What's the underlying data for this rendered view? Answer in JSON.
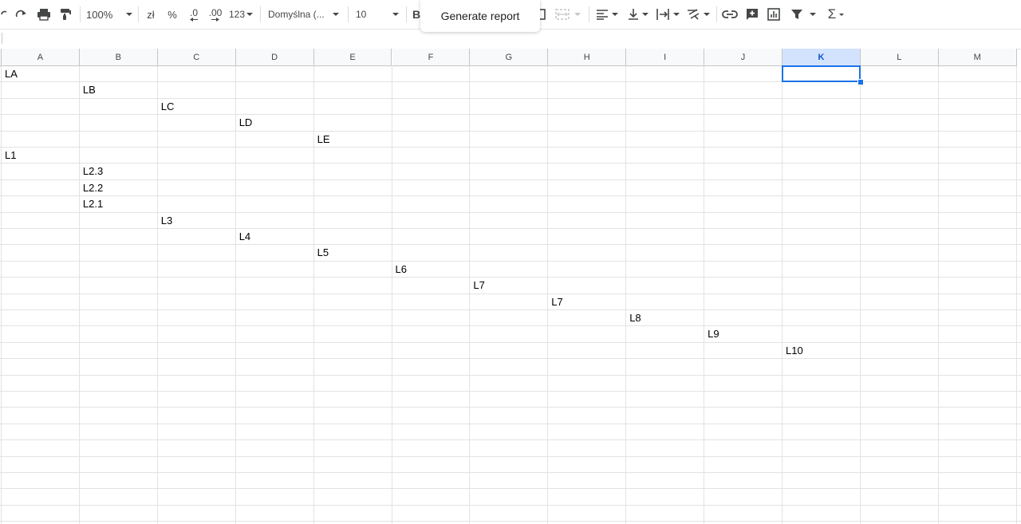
{
  "toolbar": {
    "zoom": "100%",
    "currency": "zł",
    "percent": "%",
    "decrease_decimals": ".0",
    "increase_decimals": ".00",
    "more_formats": "123",
    "font": "Domyślna (...",
    "font_size": "10"
  },
  "popup": {
    "label": "Generate report"
  },
  "columns": [
    "A",
    "B",
    "C",
    "D",
    "E",
    "F",
    "G",
    "H",
    "I",
    "J",
    "K",
    "L",
    "M"
  ],
  "selected_column": "K",
  "cells": [
    {
      "row": 1,
      "col": "A",
      "value": "LA"
    },
    {
      "row": 2,
      "col": "B",
      "value": "LB"
    },
    {
      "row": 3,
      "col": "C",
      "value": "LC"
    },
    {
      "row": 4,
      "col": "D",
      "value": "LD"
    },
    {
      "row": 5,
      "col": "E",
      "value": "LE"
    },
    {
      "row": 6,
      "col": "A",
      "value": "L1"
    },
    {
      "row": 7,
      "col": "B",
      "value": "L2.3"
    },
    {
      "row": 8,
      "col": "B",
      "value": "L2.2"
    },
    {
      "row": 9,
      "col": "B",
      "value": "L2.1"
    },
    {
      "row": 10,
      "col": "C",
      "value": "L3"
    },
    {
      "row": 11,
      "col": "D",
      "value": "L4"
    },
    {
      "row": 12,
      "col": "E",
      "value": "L5"
    },
    {
      "row": 13,
      "col": "F",
      "value": "L6"
    },
    {
      "row": 14,
      "col": "G",
      "value": "L7"
    },
    {
      "row": 15,
      "col": "H",
      "value": "L7"
    },
    {
      "row": 16,
      "col": "I",
      "value": "L8"
    },
    {
      "row": 17,
      "col": "J",
      "value": "L9"
    },
    {
      "row": 18,
      "col": "K",
      "value": "L10"
    }
  ],
  "selected_cell": {
    "row": 1,
    "col": "K"
  },
  "colors": {
    "selection": "#1a73e8",
    "header_selected": "#d3e3fd"
  }
}
